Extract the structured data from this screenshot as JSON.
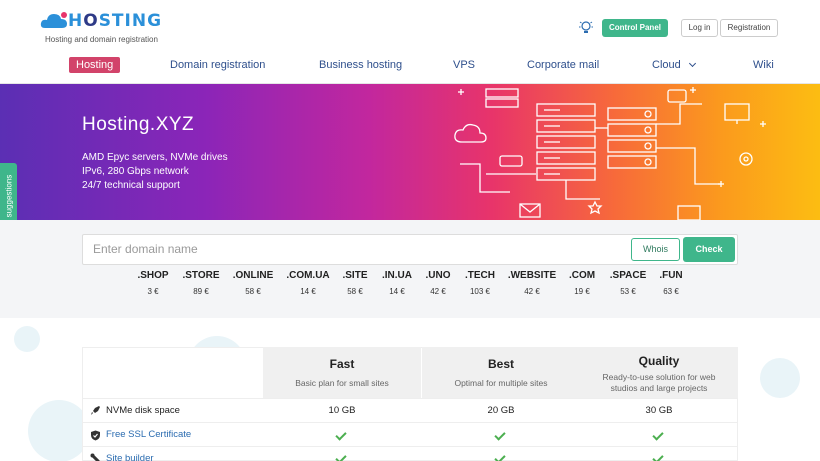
{
  "header": {
    "logo_text": "HOSTING",
    "logo_tagline": "Hosting and domain registration",
    "control_panel": "Control Panel",
    "login": "Log in",
    "registration": "Registration"
  },
  "nav": {
    "items": [
      "Hosting",
      "Domain registration",
      "Business hosting",
      "VPS",
      "Corporate mail",
      "Cloud",
      "Wiki"
    ]
  },
  "hero": {
    "title": "Hosting.XYZ",
    "lines": [
      "AMD Epyc servers, NVMe drives",
      "IPv6, 280 Gbps network",
      "24/7 technical support"
    ]
  },
  "feedback": {
    "label": "Feedback and suggestions"
  },
  "search": {
    "placeholder": "Enter domain name",
    "whois": "Whois",
    "check": "Check"
  },
  "zones": [
    {
      "name": ".SHOP",
      "price": "3 €"
    },
    {
      "name": ".STORE",
      "price": "89 €"
    },
    {
      "name": ".ONLINE",
      "price": "58 €"
    },
    {
      "name": ".COM.UA",
      "price": "14 €"
    },
    {
      "name": ".SITE",
      "price": "58 €"
    },
    {
      "name": ".IN.UA",
      "price": "14 €"
    },
    {
      "name": ".UNO",
      "price": "42 €"
    },
    {
      "name": ".TECH",
      "price": "103 €"
    },
    {
      "name": ".WEBSITE",
      "price": "42 €"
    },
    {
      "name": ".COM",
      "price": "19 €"
    },
    {
      "name": ".SPACE",
      "price": "53 €"
    },
    {
      "name": ".FUN",
      "price": "63 €"
    }
  ],
  "plans": [
    {
      "name": "Fast",
      "desc": "Basic plan for small sites"
    },
    {
      "name": "Best",
      "desc": "Optimal for multiple sites"
    },
    {
      "name": "Quality",
      "desc": "Ready-to-use solution for web studios and large projects"
    }
  ],
  "features": [
    {
      "label": "NVMe disk space",
      "icon": "rocket-icon",
      "values": [
        "10 GB",
        "20 GB",
        "30 GB"
      ]
    },
    {
      "label": "Free SSL Certificate",
      "icon": "shield-check-icon",
      "values": [
        "check",
        "check",
        "check"
      ]
    },
    {
      "label": "Site builder",
      "icon": "tools-icon",
      "values": [
        "check",
        "check",
        "check"
      ]
    }
  ],
  "colors": {
    "accent_green": "#3fb68b",
    "nav_active": "#d2436a",
    "nav_text": "#2e4f8c",
    "brand_blue": "#2b90d9"
  }
}
